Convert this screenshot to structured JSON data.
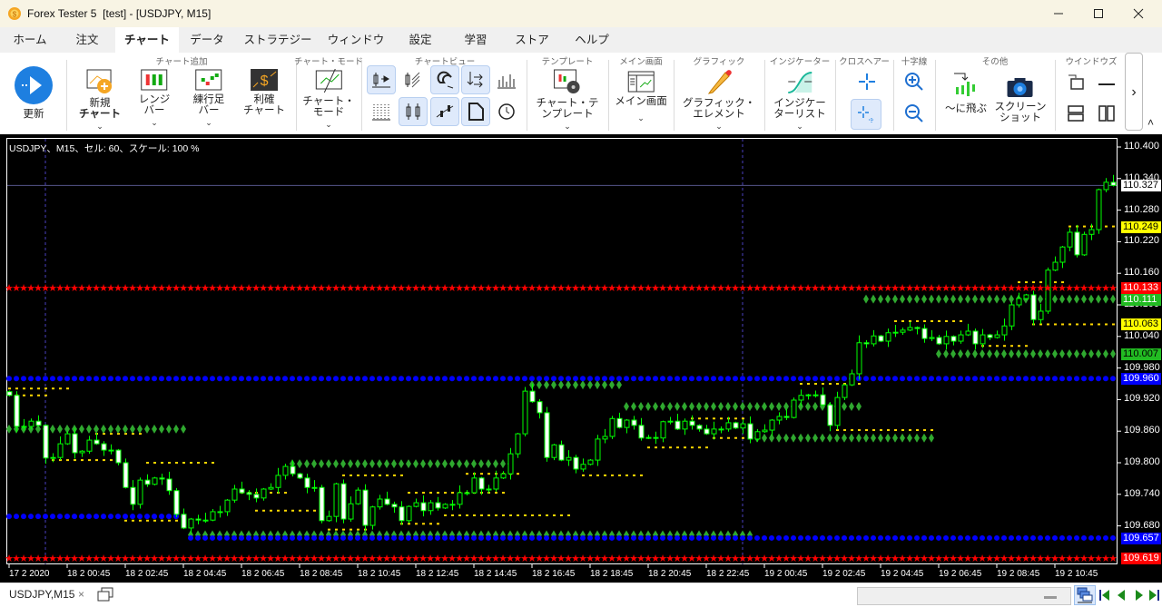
{
  "window": {
    "title": "Forex Tester 5  [test] - [USDJPY, M15]",
    "minimize": "—",
    "maximize": "☐",
    "close": "✕"
  },
  "menu_tabs": [
    "ホーム",
    "注文",
    "チャート",
    "データ",
    "ストラテジー",
    "ウィンドウ",
    "設定",
    "学習",
    "ストア",
    "ヘルプ"
  ],
  "ribbon": {
    "groups": {
      "add_chart": "チャート追加",
      "chart_mode": "チャート・モード",
      "chart_view": "チャートビュー",
      "template": "テンプレート",
      "main_screen": "メイン画面",
      "graphic": "グラフィック",
      "indicator": "インジケーター",
      "crosshair": "クロスヘアー",
      "cross": "十字線",
      "other": "その他",
      "windows": "ウインドウズ"
    },
    "refresh": "更新",
    "new_chart": [
      "新規",
      "チャート"
    ],
    "range_bar": [
      "レンジ",
      "バー"
    ],
    "renko_bar": [
      "練行足",
      "バー"
    ],
    "profit_chart": [
      "利確",
      "チャート"
    ],
    "chart_mode": [
      "チャート・",
      "モード"
    ],
    "template": [
      "チャート・テ",
      "ンプレート"
    ],
    "main_screen": "メイン画面",
    "graphic": [
      "グラフィック・",
      "エレメント"
    ],
    "indicator_list": [
      "インジケー",
      "ターリスト"
    ],
    "jump_to": "〜に飛ぶ",
    "screenshot": [
      "スクリーン",
      "ショット"
    ],
    "more": "›",
    "collapse": "˄"
  },
  "chart": {
    "info": "USDJPY、M15、セル: 60、スケール: 100 %"
  },
  "chart_data": {
    "type": "candlestick",
    "symbol": "USDJPY",
    "timeframe": "M15",
    "ylim": [
      109.6,
      110.42
    ],
    "first_open": 109.935,
    "closes": [
      109.928,
      109.869,
      109.869,
      109.879,
      109.871,
      109.809,
      109.81,
      109.836,
      109.855,
      109.819,
      109.822,
      109.843,
      109.836,
      109.824,
      109.824,
      109.8,
      109.753,
      109.721,
      109.767,
      109.759,
      109.771,
      109.769,
      109.747,
      109.702,
      109.676,
      109.693,
      109.691,
      109.691,
      109.707,
      109.707,
      109.729,
      109.75,
      109.743,
      109.74,
      109.733,
      109.75,
      109.753,
      109.776,
      109.793,
      109.779,
      109.771,
      109.753,
      109.753,
      109.69,
      109.698,
      109.76,
      109.693,
      109.722,
      109.748,
      109.681,
      109.716,
      109.731,
      109.721,
      109.716,
      109.69,
      109.717,
      109.724,
      109.709,
      109.724,
      109.714,
      109.721,
      109.721,
      109.743,
      109.743,
      109.771,
      109.75,
      109.75,
      109.771,
      109.779,
      109.817,
      109.855,
      109.936,
      109.916,
      109.895,
      109.81,
      109.834,
      109.805,
      109.81,
      109.788,
      109.797,
      109.805,
      109.845,
      109.85,
      109.884,
      109.867,
      109.881,
      109.871,
      109.847,
      109.848,
      109.847,
      109.878,
      109.879,
      109.864,
      109.879,
      109.871,
      109.864,
      109.855,
      109.864,
      109.864,
      109.876,
      109.866,
      109.874,
      109.845,
      109.859,
      109.862,
      109.881,
      109.888,
      109.886,
      109.919,
      109.928,
      109.929,
      109.929,
      109.91,
      109.871,
      109.924,
      109.948,
      109.969,
      110.028,
      110.026,
      110.041,
      110.031,
      110.047,
      110.048,
      110.052,
      110.057,
      110.055,
      110.036,
      110.038,
      110.026,
      110.04,
      110.031,
      110.043,
      110.05,
      110.026,
      110.043,
      110.038,
      110.043,
      110.06,
      110.1,
      110.112,
      110.119,
      110.072,
      110.088,
      110.166,
      110.181,
      110.21,
      110.238,
      110.195,
      110.234,
      110.243,
      110.319,
      110.333,
      110.327
    ],
    "current_price": 110.327,
    "price_ticks": [
      "110.400",
      "110.340",
      "110.280",
      "110.220",
      "110.160",
      "110.100",
      "110.040",
      "109.980",
      "109.920",
      "109.860",
      "109.800",
      "109.740",
      "109.680"
    ],
    "time_labels": [
      {
        "bar": 0,
        "label": "17 2 2020"
      },
      {
        "bar": 8,
        "label": "18 2 00:45"
      },
      {
        "bar": 16,
        "label": "18 2 02:45"
      },
      {
        "bar": 24,
        "label": "18 2 04:45"
      },
      {
        "bar": 32,
        "label": "18 2 06:45"
      },
      {
        "bar": 40,
        "label": "18 2 08:45"
      },
      {
        "bar": 48,
        "label": "18 2 10:45"
      },
      {
        "bar": 56,
        "label": "18 2 12:45"
      },
      {
        "bar": 64,
        "label": "18 2 14:45"
      },
      {
        "bar": 72,
        "label": "18 2 16:45"
      },
      {
        "bar": 80,
        "label": "18 2 18:45"
      },
      {
        "bar": 88,
        "label": "18 2 20:45"
      },
      {
        "bar": 96,
        "label": "18 2 22:45"
      },
      {
        "bar": 104,
        "label": "19 2 00:45"
      },
      {
        "bar": 112,
        "label": "19 2 02:45"
      },
      {
        "bar": 120,
        "label": "19 2 04:45"
      },
      {
        "bar": 128,
        "label": "19 2 06:45"
      },
      {
        "bar": 136,
        "label": "19 2 08:45"
      },
      {
        "bar": 144,
        "label": "19 2 10:45"
      }
    ],
    "vertical_separators": [
      5,
      101
    ],
    "star_lines": [
      {
        "price": 110.133,
        "from": 0,
        "to": 152
      },
      {
        "price": 109.619,
        "from": 0,
        "to": 152
      }
    ],
    "dot_lines": [
      {
        "price": 109.96,
        "from": 0,
        "to": 152
      },
      {
        "price": 109.698,
        "from": 0,
        "to": 24
      },
      {
        "price": 109.657,
        "from": 25,
        "to": 152
      }
    ],
    "diamond_lines": [
      {
        "price": 109.864,
        "from": 0,
        "to": 24
      },
      {
        "price": 109.798,
        "from": 39,
        "to": 69
      },
      {
        "price": 109.663,
        "from": 25,
        "to": 102
      },
      {
        "price": 109.948,
        "from": 72,
        "to": 84
      },
      {
        "price": 109.907,
        "from": 85,
        "to": 117
      },
      {
        "price": 109.847,
        "from": 103,
        "to": 127
      },
      {
        "price": 110.111,
        "from": 118,
        "to": 152
      },
      {
        "price": 110.007,
        "from": 128,
        "to": 152
      }
    ],
    "yellow_lines": [
      {
        "price": 109.941,
        "from": 0,
        "to": 8
      },
      {
        "price": 109.928,
        "from": 1,
        "to": 5
      },
      {
        "price": 109.805,
        "from": 6,
        "to": 15
      },
      {
        "price": 109.855,
        "from": 12,
        "to": 18
      },
      {
        "price": 109.8,
        "from": 19,
        "to": 28
      },
      {
        "price": 109.69,
        "from": 16,
        "to": 24
      },
      {
        "price": 109.743,
        "from": 31,
        "to": 38
      },
      {
        "price": 109.709,
        "from": 34,
        "to": 43
      },
      {
        "price": 109.776,
        "from": 46,
        "to": 54
      },
      {
        "price": 109.743,
        "from": 55,
        "to": 68
      },
      {
        "price": 109.7,
        "from": 60,
        "to": 77
      },
      {
        "price": 109.684,
        "from": 54,
        "to": 59
      },
      {
        "price": 109.673,
        "from": 44,
        "to": 49
      },
      {
        "price": 109.779,
        "from": 63,
        "to": 70
      },
      {
        "price": 109.776,
        "from": 79,
        "to": 87
      },
      {
        "price": 109.829,
        "from": 88,
        "to": 96
      },
      {
        "price": 109.884,
        "from": 94,
        "to": 101
      },
      {
        "price": 109.847,
        "from": 97,
        "to": 110
      },
      {
        "price": 109.95,
        "from": 109,
        "to": 117
      },
      {
        "price": 109.862,
        "from": 114,
        "to": 127
      },
      {
        "price": 110.069,
        "from": 122,
        "to": 131
      },
      {
        "price": 110.022,
        "from": 134,
        "to": 140
      },
      {
        "price": 110.143,
        "from": 139,
        "to": 145
      },
      {
        "price": 110.063,
        "from": 141,
        "to": 152
      },
      {
        "price": 110.249,
        "from": 146,
        "to": 152
      }
    ],
    "price_badges": [
      {
        "label": "110.327",
        "price": 110.327,
        "bg": "#ffffff",
        "fg": "#000000"
      },
      {
        "label": "110.249",
        "price": 110.249,
        "bg": "#ffff00",
        "fg": "#000000"
      },
      {
        "label": "110.133",
        "price": 110.133,
        "bg": "#ff0000",
        "fg": "#ffffff"
      },
      {
        "label": "110.111",
        "price": 110.111,
        "bg": "#22bb22",
        "fg": "#ffffff"
      },
      {
        "label": "110.063",
        "price": 110.063,
        "bg": "#ffff00",
        "fg": "#000000"
      },
      {
        "label": "110.007",
        "price": 110.007,
        "bg": "#22bb22",
        "fg": "#000000"
      },
      {
        "label": "109.960",
        "price": 109.96,
        "bg": "#0000ff",
        "fg": "#ffffff"
      },
      {
        "label": "109.657",
        "price": 109.657,
        "bg": "#0000ff",
        "fg": "#ffffff"
      },
      {
        "label": "109.619",
        "price": 109.619,
        "bg": "#ff0000",
        "fg": "#ffffff"
      }
    ],
    "colors": {
      "candle": "#00ff00",
      "bear_fill": "#ffffff",
      "star": "#ff0000",
      "dot": "#0000ff",
      "diamond": "#2fa82f",
      "yellow": "#ffd700",
      "price_line": "#55558a",
      "separator": "#4a3fbf"
    }
  },
  "bottom": {
    "tab": "USDJPY,M15",
    "tab_close": "×"
  }
}
